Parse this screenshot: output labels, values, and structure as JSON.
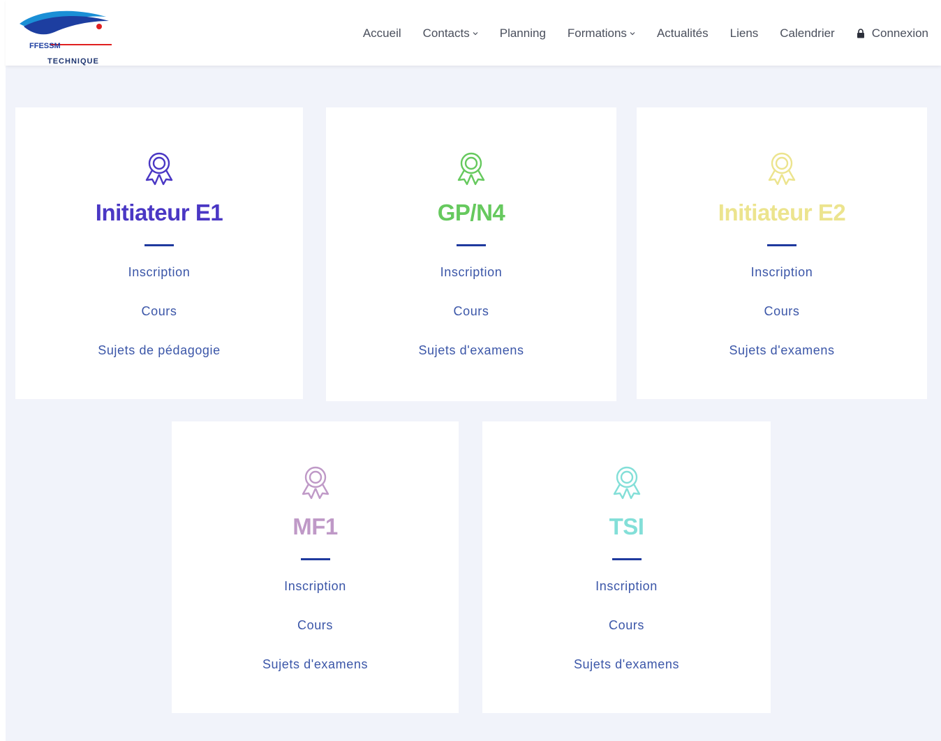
{
  "brand": {
    "logo_text": "TECHNIQUE",
    "logo_mark": "FFESSM"
  },
  "nav": {
    "items": [
      {
        "label": "Accueil"
      },
      {
        "label": "Contacts",
        "dropdown": true
      },
      {
        "label": "Planning"
      },
      {
        "label": "Formations",
        "dropdown": true
      },
      {
        "label": "Actualités"
      },
      {
        "label": "Liens"
      },
      {
        "label": "Calendrier"
      }
    ],
    "login": "Connexion"
  },
  "cards": [
    {
      "title": "Initiateur E1",
      "color": "#4a37c4",
      "links": [
        "Inscription",
        "Cours",
        "Sujets de pédagogie"
      ]
    },
    {
      "title": "GP/N4",
      "color": "#66c95e",
      "links": [
        "Inscription",
        "Cours",
        "Sujets d'examens"
      ]
    },
    {
      "title": "Initiateur E2",
      "color": "#ece48e",
      "links": [
        "Inscription",
        "Cours",
        "Sujets d'examens"
      ]
    },
    {
      "title": "MF1",
      "color": "#bf99c7",
      "links": [
        "Inscription",
        "Cours",
        "Sujets d'examens"
      ]
    },
    {
      "title": "TSI",
      "color": "#83dfd8",
      "links": [
        "Inscription",
        "Cours",
        "Sujets d'examens"
      ]
    }
  ],
  "colors": {
    "accent": "#1f3a9e",
    "link": "#3b56a8",
    "background": "#f1f3fa"
  }
}
